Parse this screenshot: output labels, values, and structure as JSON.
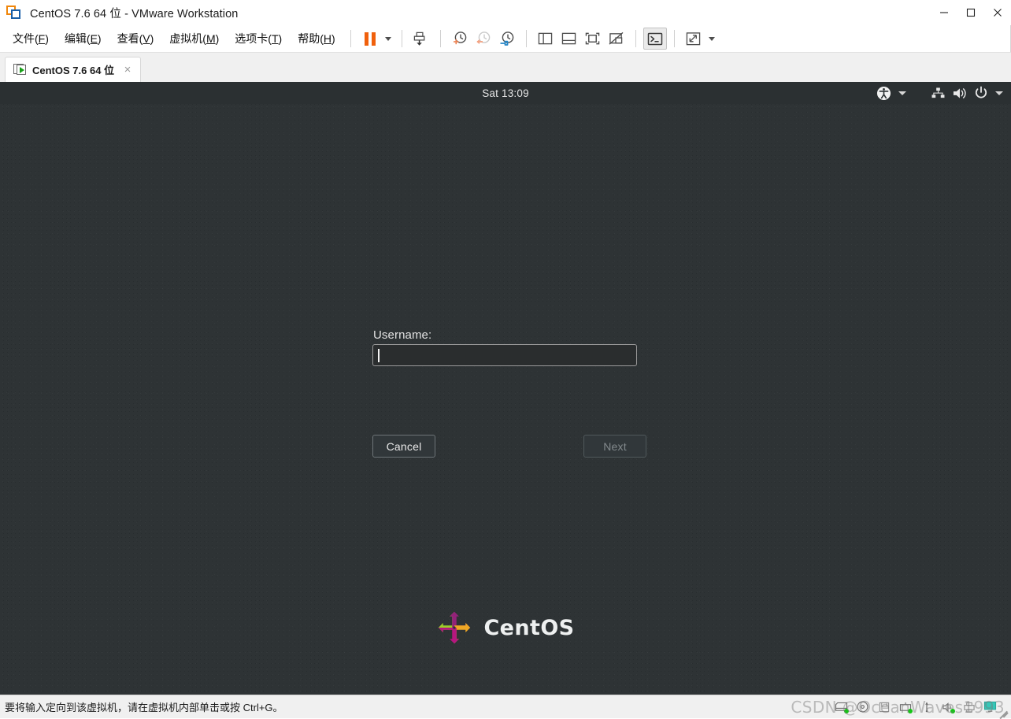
{
  "window": {
    "title": "CentOS 7.6 64 位 - VMware Workstation",
    "app_icon": "vmware-logo-icon",
    "controls": {
      "minimize": "minimize-button",
      "maximize": "maximize-button",
      "close": "close-button"
    }
  },
  "menubar": {
    "items": [
      {
        "label": "文件(F)",
        "text": "文件(",
        "mnemonic": "F",
        "tail": ")"
      },
      {
        "label": "编辑(E)",
        "text": "编辑(",
        "mnemonic": "E",
        "tail": ")"
      },
      {
        "label": "查看(V)",
        "text": "查看(",
        "mnemonic": "V",
        "tail": ")"
      },
      {
        "label": "虚拟机(M)",
        "text": "虚拟机(",
        "mnemonic": "M",
        "tail": ")"
      },
      {
        "label": "选项卡(T)",
        "text": "选项卡(",
        "mnemonic": "T",
        "tail": ")"
      },
      {
        "label": "帮助(H)",
        "text": "帮助(",
        "mnemonic": "H",
        "tail": ")"
      }
    ]
  },
  "toolbar": {
    "accent_color": "#f0600c",
    "buttons": [
      {
        "name": "suspend-button",
        "icon": "pause-icon"
      },
      {
        "name": "suspend-dropdown",
        "icon": "chevron-down-icon"
      },
      {
        "name": "power-button",
        "icon": "power-down-icon"
      },
      {
        "name": "snapshot-take-button",
        "icon": "clock-plus-icon"
      },
      {
        "name": "snapshot-revert-button",
        "icon": "clock-back-icon"
      },
      {
        "name": "snapshot-manager-button",
        "icon": "clock-wrench-icon"
      },
      {
        "name": "show-sidebar-button",
        "icon": "sidebar-panel-icon"
      },
      {
        "name": "show-bottom-panel-button",
        "icon": "bottom-panel-icon"
      },
      {
        "name": "fit-window-button",
        "icon": "fit-frame-icon"
      },
      {
        "name": "thumbnail-off-button",
        "icon": "thumbnail-disabled-icon"
      },
      {
        "name": "console-view-button",
        "icon": "terminal-icon",
        "active": true
      },
      {
        "name": "fullscreen-button",
        "icon": "expand-arrows-icon"
      },
      {
        "name": "fullscreen-dropdown",
        "icon": "chevron-down-icon"
      }
    ]
  },
  "tabs": [
    {
      "label": "CentOS 7.6 64 位",
      "icon": "vm-running-icon",
      "close": "×",
      "active": true
    }
  ],
  "guest": {
    "topbar": {
      "clock": "Sat 13:09",
      "status_icons": [
        {
          "name": "accessibility-icon",
          "glyph": "accessibility"
        },
        {
          "name": "accessibility-dropdown-icon",
          "glyph": "chevron-down"
        },
        {
          "name": "network-icon",
          "glyph": "network"
        },
        {
          "name": "volume-icon",
          "glyph": "volume"
        },
        {
          "name": "power-icon",
          "glyph": "power"
        },
        {
          "name": "system-menu-dropdown-icon",
          "glyph": "chevron-down"
        }
      ]
    },
    "login": {
      "username_label": "Username:",
      "username_value": "",
      "cancel_label": "Cancel",
      "next_label": "Next",
      "next_disabled": true
    },
    "branding": {
      "name": "CentOS",
      "logo_colors": {
        "green": "#9ccd2a",
        "purple": "#932279",
        "orange": "#efa724",
        "magenta": "#b5177f",
        "violet": "#623a8e"
      }
    },
    "background_color": "#2e3335"
  },
  "statusbar": {
    "message": "要将输入定向到该虚拟机，请在虚拟机内部单击或按 Ctrl+G。",
    "devices": [
      {
        "name": "hard-disk-icon",
        "connected": true
      },
      {
        "name": "cd-dvd-icon",
        "connected": true
      },
      {
        "name": "floppy-icon",
        "connected": false
      },
      {
        "name": "network-adapter-icon",
        "connected": true
      },
      {
        "name": "usb-icon",
        "connected": true
      },
      {
        "name": "sound-card-icon",
        "connected": true
      },
      {
        "name": "printer-icon",
        "connected": false
      },
      {
        "name": "display-icon",
        "connected": false
      }
    ],
    "watermark": "CSDN @OceanWaves1993"
  }
}
